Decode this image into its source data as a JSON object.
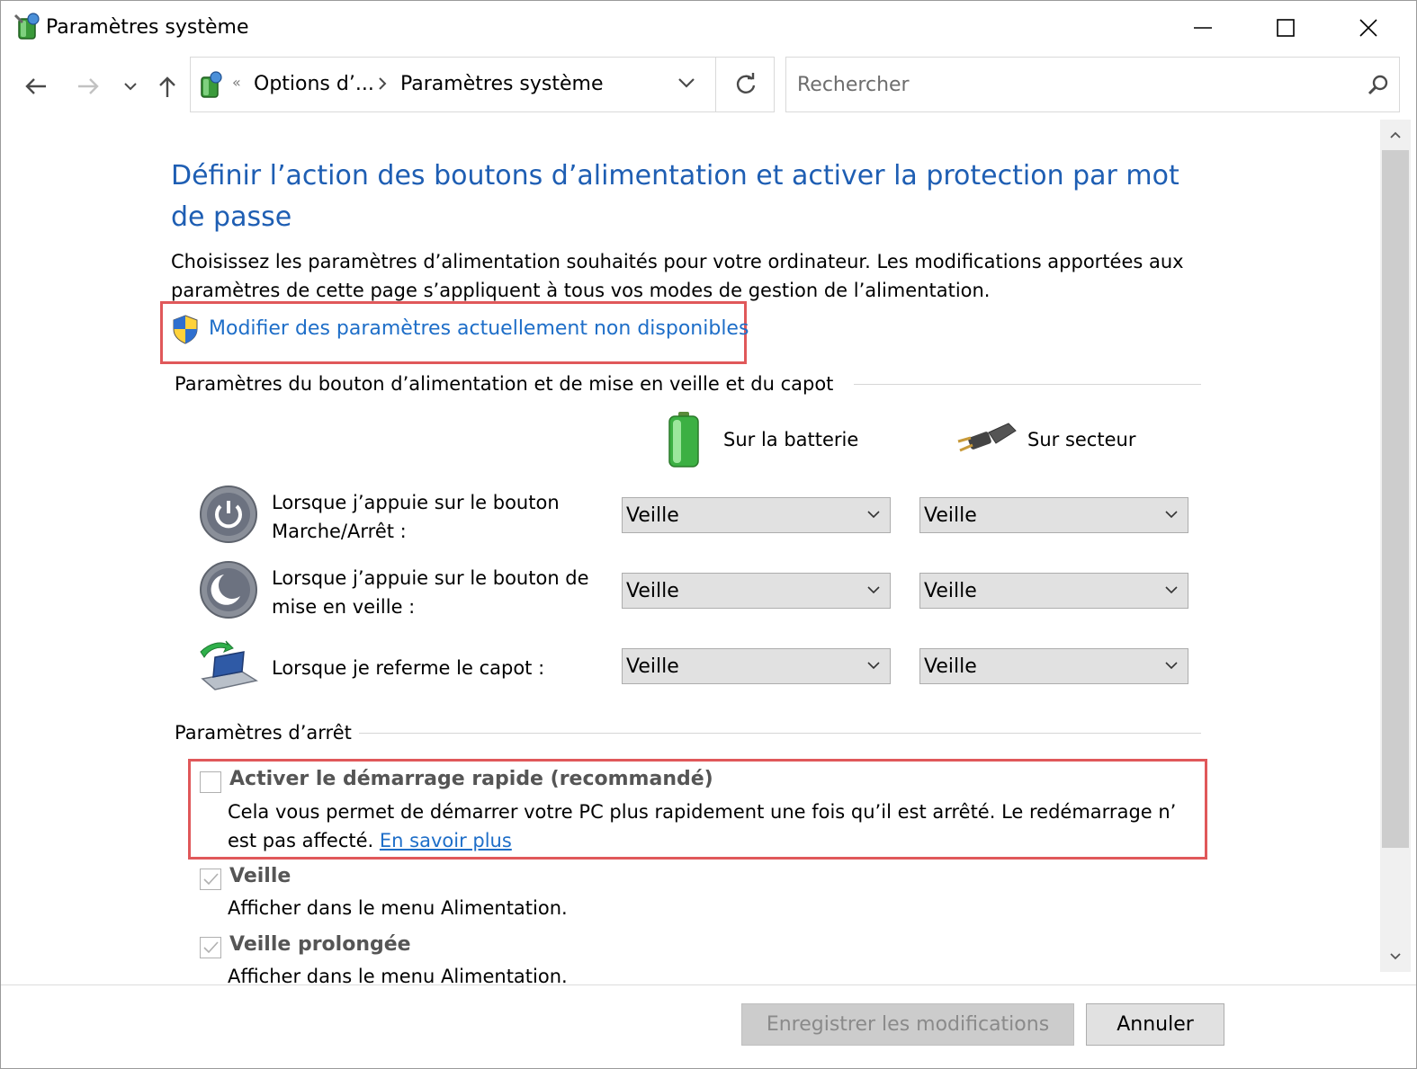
{
  "window": {
    "title": "Paramètres système"
  },
  "address": {
    "crumbs": [
      "Options d’...",
      "Paramètres système"
    ],
    "overflow_glyph": "«"
  },
  "search": {
    "placeholder": "Rechercher"
  },
  "page": {
    "title": "Définir l’action des boutons d’alimentation et activer la protection par mot de passe",
    "intro": "Choisissez les paramètres d’alimentation souhaités pour votre ordinateur. Les modifications apportées aux paramètres de cette page s’appliquent à tous vos modes de gestion de l’alimentation.",
    "modify_link": "Modifier des paramètres actuellement non disponibles"
  },
  "power_buttons": {
    "group_title": "Paramètres du bouton d’alimentation et de mise en veille et du capot",
    "col_battery": "Sur la batterie",
    "col_plugged": "Sur secteur",
    "rows": [
      {
        "label": "Lorsque j’appuie sur le bouton Marche/Arrêt :",
        "battery": "Veille",
        "plugged": "Veille"
      },
      {
        "label": "Lorsque j’appuie sur le bouton de mise en veille :",
        "battery": "Veille",
        "plugged": "Veille"
      },
      {
        "label": "Lorsque je referme le capot :",
        "battery": "Veille",
        "plugged": "Veille"
      }
    ]
  },
  "shutdown": {
    "group_title": "Paramètres d’arrêt",
    "items": [
      {
        "label": "Activer le démarrage rapide (recommandé)",
        "desc": "Cela vous permet de démarrer votre PC plus rapidement une fois qu’il est arrêté. Le redémarrage n’ est pas affecté.",
        "link": "En savoir plus",
        "checked": false
      },
      {
        "label": "Veille",
        "desc": "Afficher dans le menu Alimentation.",
        "checked": true
      },
      {
        "label": "Veille prolongée",
        "desc": "Afficher dans le menu Alimentation.",
        "checked": true
      }
    ]
  },
  "footer": {
    "save": "Enregistrer les modifications",
    "cancel": "Annuler"
  },
  "colors": {
    "title_blue": "#1e5eb3",
    "link_blue": "#1e6ec8",
    "highlight_red": "#e0585a"
  }
}
